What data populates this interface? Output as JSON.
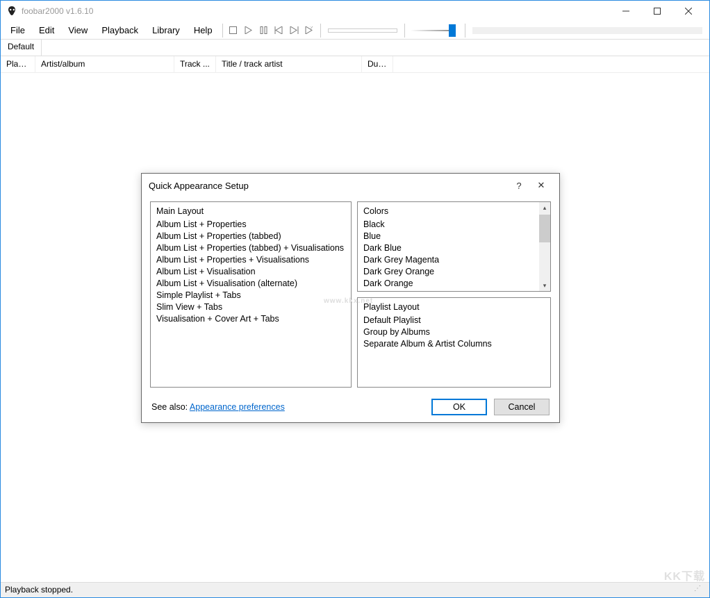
{
  "titlebar": {
    "title": "foobar2000 v1.6.10"
  },
  "menu": {
    "items": [
      "File",
      "Edit",
      "View",
      "Playback",
      "Library",
      "Help"
    ]
  },
  "tabbar": {
    "tab": "Default"
  },
  "columns": {
    "playing": "Playi...",
    "artist": "Artist/album",
    "track": "Track ...",
    "title": "Title / track artist",
    "duration": "Dura..."
  },
  "dialog": {
    "title": "Quick Appearance Setup",
    "help": "?",
    "close": "✕",
    "main_layout_heading": "Main Layout",
    "main_layout_items": [
      "Album List + Properties",
      "Album List + Properties (tabbed)",
      "Album List + Properties (tabbed) + Visualisations",
      "Album List + Properties + Visualisations",
      "Album List + Visualisation",
      "Album List + Visualisation (alternate)",
      "Simple Playlist + Tabs",
      "Slim View + Tabs",
      "Visualisation + Cover Art + Tabs"
    ],
    "colors_heading": "Colors",
    "colors_items": [
      "Black",
      "Blue",
      "Dark Blue",
      "Dark Grey Magenta",
      "Dark Grey Orange",
      "Dark Orange"
    ],
    "playlist_heading": "Playlist Layout",
    "playlist_items": [
      "Default Playlist",
      "Group by Albums",
      "Separate Album & Artist Columns"
    ],
    "see_also_label": "See also:",
    "see_also_link": "Appearance preferences",
    "ok": "OK",
    "cancel": "Cancel"
  },
  "status": {
    "text": "Playback stopped."
  },
  "watermark": {
    "text": "www.kkx.net",
    "logo": "KK下载"
  }
}
